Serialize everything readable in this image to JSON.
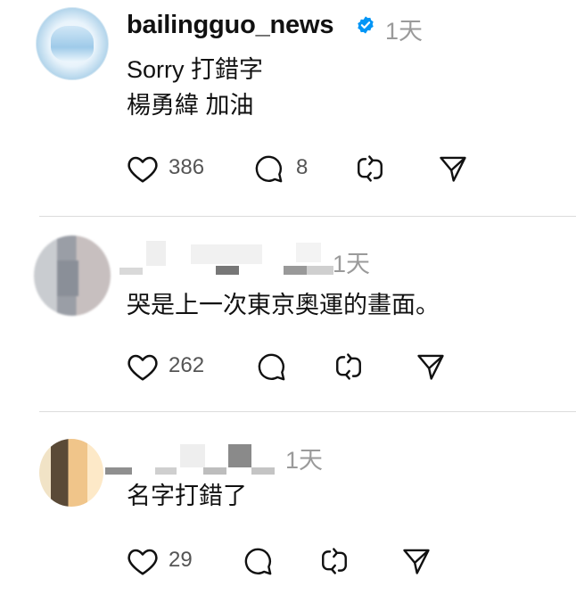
{
  "posts": [
    {
      "username": "bailingguo_news",
      "verified": true,
      "time": "1天",
      "content": "Sorry 打錯字\n楊勇緯 加油",
      "likes": "386",
      "comments": "8"
    },
    {
      "username": "",
      "time": "1天",
      "content": "哭是上一次東京奧運的畫面。",
      "likes": "262",
      "comments": ""
    },
    {
      "username": "",
      "time": "1天",
      "content": "名字打錯了",
      "likes": "29",
      "comments": ""
    }
  ],
  "icons": {
    "like": "heart-icon",
    "comment": "comment-icon",
    "repost": "repost-icon",
    "share": "send-icon",
    "verified": "verified-badge-icon"
  },
  "colors": {
    "verified": "#0095f6",
    "text": "#111111",
    "muted": "#9a9a9a",
    "divider": "#dcdcdc"
  }
}
